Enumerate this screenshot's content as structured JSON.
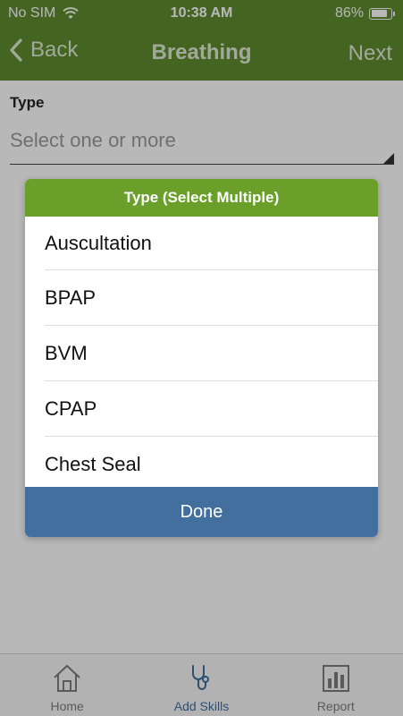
{
  "status_bar": {
    "carrier": "No SIM",
    "time": "10:38 AM",
    "battery": "86%",
    "battery_level": 0.86
  },
  "nav": {
    "back_label": "Back",
    "title": "Breathing",
    "next_label": "Next"
  },
  "form": {
    "type_label": "Type",
    "type_placeholder": "Select one or more"
  },
  "modal": {
    "title": "Type (Select Multiple)",
    "options": [
      "Auscultation",
      "BPAP",
      "BVM",
      "CPAP",
      "Chest Seal"
    ],
    "done_label": "Done"
  },
  "tab_bar": {
    "items": [
      {
        "label": "Home",
        "icon": "home-icon",
        "active": false
      },
      {
        "label": "Add Skills",
        "icon": "stethoscope-icon",
        "active": true
      },
      {
        "label": "Report",
        "icon": "report-chart-icon",
        "active": false
      }
    ]
  },
  "colors": {
    "nav_green": "#5e8c2e",
    "modal_header_green": "#6aa02a",
    "done_blue": "#436f9f",
    "active_tab_blue": "#3e6fa0"
  }
}
